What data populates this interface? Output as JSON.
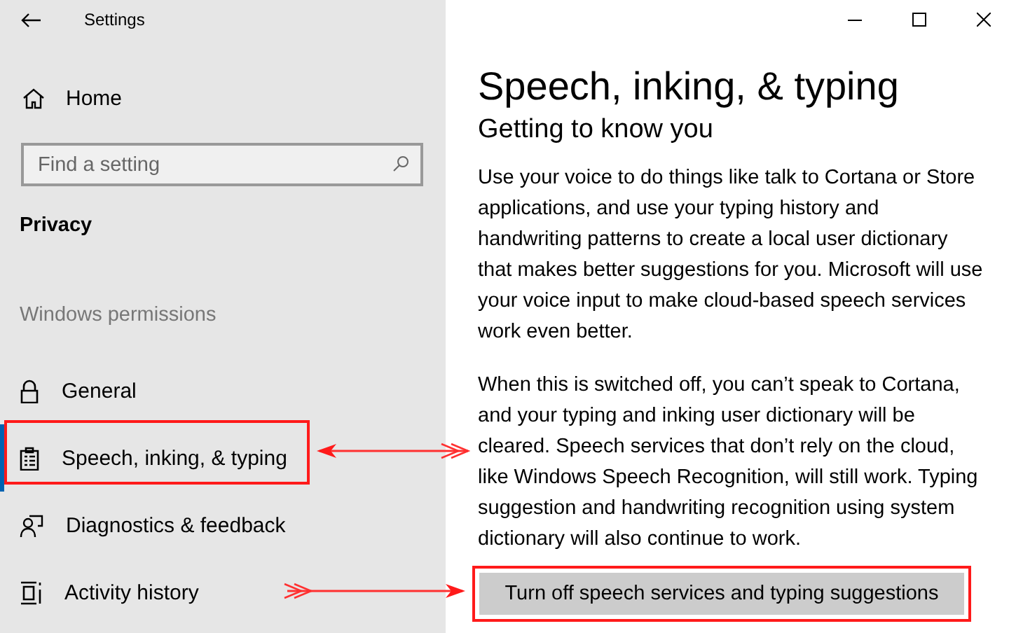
{
  "window": {
    "title": "Settings"
  },
  "sidebar": {
    "home": "Home",
    "search": {
      "placeholder": "Find a setting"
    },
    "section": "Privacy",
    "group": "Windows permissions",
    "items": [
      {
        "label": "General",
        "selected": false
      },
      {
        "label": "Speech, inking, & typing",
        "selected": true
      },
      {
        "label": "Diagnostics & feedback",
        "selected": false
      },
      {
        "label": "Activity history",
        "selected": false
      }
    ]
  },
  "content": {
    "title": "Speech, inking, & typing",
    "subtitle": "Getting to know you",
    "paragraphs": [
      "Use your voice to do things like talk to Cortana or Store applications, and use your typing history and handwriting patterns to create a local user dictionary that makes better suggestions for you. Microsoft will use your voice input to make cloud-based speech services work even better.",
      "When this is switched off, you can’t speak to Cortana, and your typing and inking user dictionary will be cleared. Speech services that don’t rely on the cloud, like Windows Speech Recognition, will still work. Typing suggestion and handwriting recognition using system dictionary will also continue to work."
    ],
    "button": "Turn off speech services and typing suggestions"
  }
}
